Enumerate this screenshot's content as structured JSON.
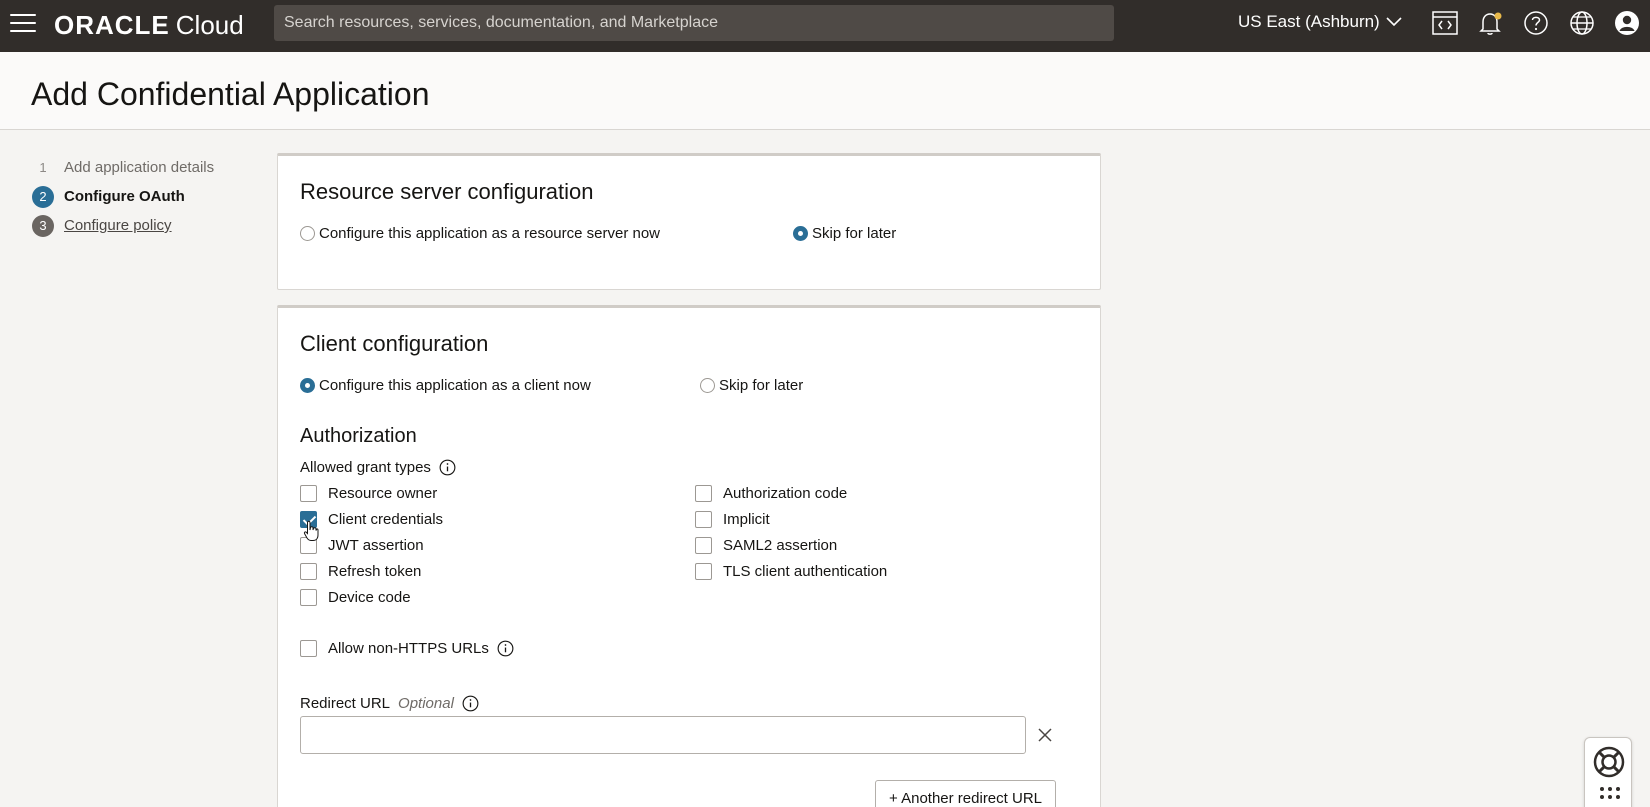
{
  "topbar": {
    "brand_name": "ORACLE",
    "brand_product": "Cloud",
    "search_placeholder": "Search resources, services, documentation, and Marketplace",
    "region": "US East (Ashburn)",
    "icons": [
      "menu-icon",
      "code-editor-icon",
      "bell-icon",
      "help-icon",
      "globe-icon",
      "user-icon"
    ]
  },
  "page": {
    "title": "Add Confidential Application"
  },
  "steps": [
    {
      "number": "1",
      "label": "Add application details",
      "state": "done"
    },
    {
      "number": "2",
      "label": "Configure OAuth",
      "state": "current"
    },
    {
      "number": "3",
      "label": "Configure policy",
      "state": "next"
    }
  ],
  "resource_server": {
    "title": "Resource server configuration",
    "option_now": "Configure this application as a resource server now",
    "option_later": "Skip for later",
    "selected": "later"
  },
  "client": {
    "title": "Client configuration",
    "option_now": "Configure this application as a client now",
    "option_later": "Skip for later",
    "selected": "now",
    "authorization_title": "Authorization",
    "grant_types_label": "Allowed grant types",
    "grants_left": [
      {
        "label": "Resource owner",
        "checked": false
      },
      {
        "label": "Client credentials",
        "checked": true
      },
      {
        "label": "JWT assertion",
        "checked": false
      },
      {
        "label": "Refresh token",
        "checked": false
      },
      {
        "label": "Device code",
        "checked": false
      }
    ],
    "grants_right": [
      {
        "label": "Authorization code",
        "checked": false
      },
      {
        "label": "Implicit",
        "checked": false
      },
      {
        "label": "SAML2 assertion",
        "checked": false
      },
      {
        "label": "TLS client authentication",
        "checked": false
      }
    ],
    "allow_non_https_label": "Allow non-HTTPS URLs",
    "allow_non_https_checked": false,
    "redirect_url_label": "Redirect URL",
    "redirect_url_optional": "Optional",
    "redirect_url_value": "",
    "another_redirect_button": "+ Another redirect URL"
  },
  "colors": {
    "topbar": "#312d2a",
    "accent": "#2a6e96",
    "search_bg": "#4f4a46"
  }
}
